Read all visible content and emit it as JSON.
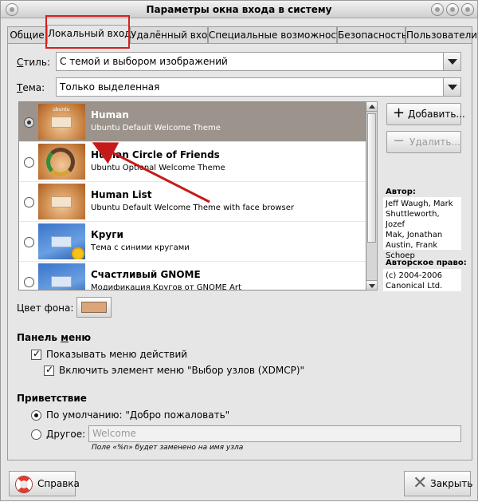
{
  "window": {
    "title": "Параметры окна входа в систему"
  },
  "tabs": [
    {
      "label": "Общие"
    },
    {
      "label": "Локальный вход"
    },
    {
      "label": "Удалённый вход"
    },
    {
      "label": "Специальные возможности"
    },
    {
      "label": "Безопасность"
    },
    {
      "label": "Пользователи"
    }
  ],
  "active_tab": "Локальный вход",
  "style_row": {
    "label_mnemonic": "С",
    "label_rest": "тиль:",
    "value": "С темой и выбором изображений"
  },
  "theme_row": {
    "label_mnemonic": "Т",
    "label_rest": "ема:",
    "value": "Только выделенная"
  },
  "themes": [
    {
      "name": "Human",
      "description": "Ubuntu Default Welcome Theme",
      "selected": true
    },
    {
      "name": "Human Circle of Friends",
      "description": "Ubuntu Optional Welcome Theme",
      "selected": false
    },
    {
      "name": "Human List",
      "description": "Ubuntu Default Welcome Theme with face browser",
      "selected": false
    },
    {
      "name": "Круги",
      "description": "Тема с синими кругами",
      "selected": false
    },
    {
      "name": "Счастливый GNOME",
      "description": "Модификация Кругов от GNOME Art",
      "selected": false
    }
  ],
  "thumb_labels": {
    "ubuntu": "ubuntu"
  },
  "buttons": {
    "add": "Добавить...",
    "remove": "Удалить...",
    "help": "Справка",
    "close": "Закрыть"
  },
  "author": {
    "label": "Автор:",
    "lines": [
      "Jeff Waugh, Mark",
      "Shuttleworth, Jozef",
      "Mak, Jonathan",
      "Austin, Frank",
      "Schoep"
    ]
  },
  "copyright": {
    "label": "Авторское право:",
    "lines": [
      "(c) 2004-2006",
      "Canonical Ltd."
    ]
  },
  "background_color": {
    "label": "Цвет фона:",
    "value": "#dba57a"
  },
  "menu_panel": {
    "title_mnemonic_before": "Панель ",
    "title_mnemonic": "м",
    "title_after": "еню",
    "show_actions": {
      "label": "Показывать меню действий",
      "checked": true
    },
    "xdmcp": {
      "label": "Включить элемент меню \"Выбор узлов (XDMCP)\"",
      "checked": true
    }
  },
  "greeting": {
    "title": "Приветствие",
    "default_option": {
      "label": "По умолчанию: \"Добро пожаловать\"",
      "selected": true
    },
    "other_option": {
      "label": "Другое:",
      "selected": false
    },
    "other_value": "Welcome",
    "hint": "Поле «%n» будет заменено на имя узла"
  },
  "colors": {
    "window_bg": "#e6e6e6",
    "selection_bg": "#9c948c",
    "annotation_red": "#d62020"
  }
}
